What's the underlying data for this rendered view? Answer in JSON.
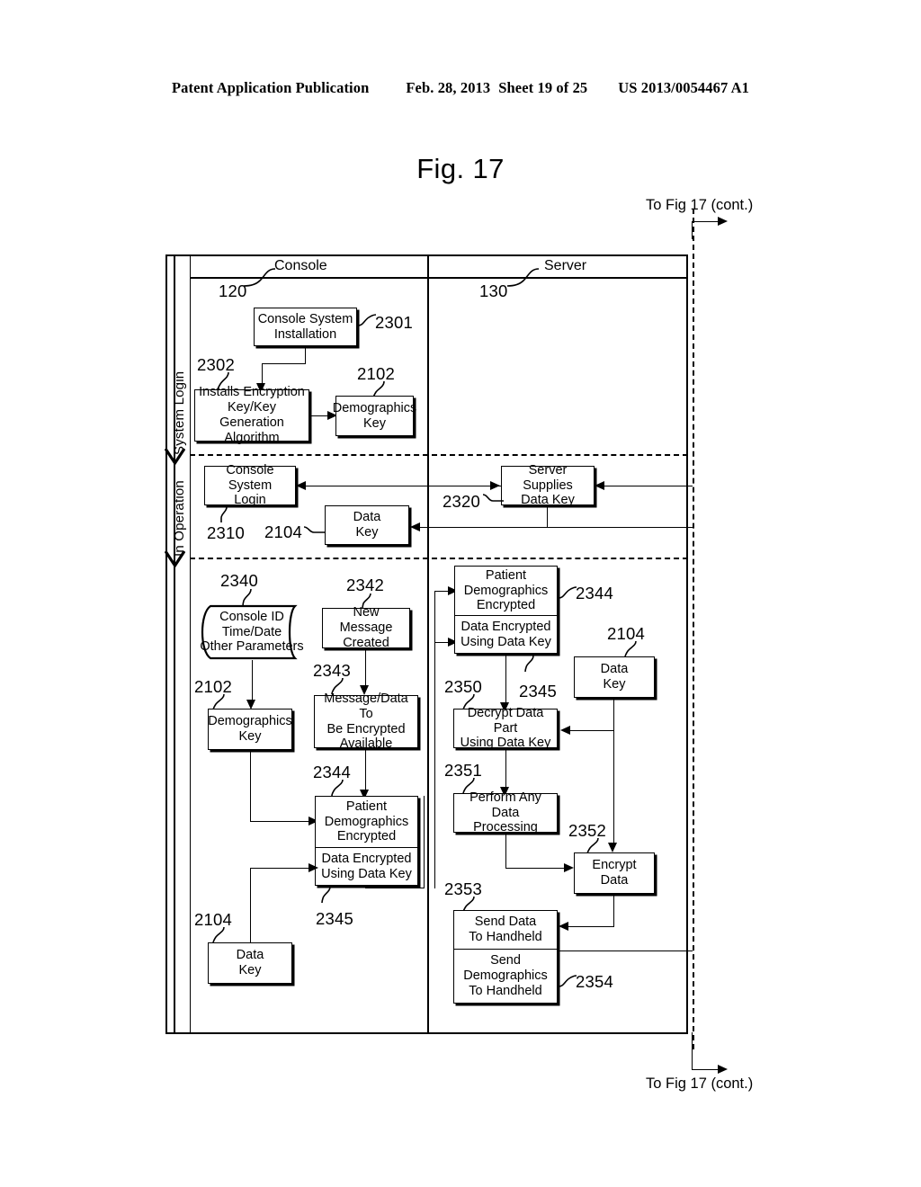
{
  "header": {
    "publication": "Patent Application Publication",
    "date": "Feb. 28, 2013",
    "sheet": "Sheet 19 of 25",
    "patent_number": "US 2013/0054467 A1"
  },
  "figure": {
    "title": "Fig. 17",
    "continuation_top": "To Fig 17 (cont.)",
    "continuation_bottom": "To Fig 17 (cont.)"
  },
  "columns": [
    {
      "label": "Console",
      "ref": "120"
    },
    {
      "label": "Server",
      "ref": "130"
    }
  ],
  "bands": [
    {
      "label": "System Login"
    },
    {
      "label": "In Operation"
    }
  ],
  "nodes": {
    "console_system_installation": {
      "text": "Console System\nInstallation",
      "ref": "2301"
    },
    "installs_encryption_key": {
      "text": "Installs Encryption\nKey/Key Generation\nAlgorithm",
      "ref": "2302"
    },
    "demographics_key_top": {
      "text": "Demographics\nKey",
      "ref": "2102"
    },
    "console_system_login": {
      "text": "Console System\nLogin",
      "ref": "2310"
    },
    "data_key_operation": {
      "text": "Data\nKey",
      "ref": "2104"
    },
    "server_supplies_data_key": {
      "text": "Server Supplies\nData Key",
      "ref": "2320"
    },
    "console_id_params": {
      "text": "Console ID\nTime/Date\nOther Parameters",
      "ref": "2340"
    },
    "new_message_created": {
      "text": "New Message\nCreated",
      "ref": "2342"
    },
    "message_data_to_be_encrypted": {
      "text": "Message/Data To\nBe Encrypted\nAvailable",
      "ref": "2343"
    },
    "demographics_key_console": {
      "text": "Demographics\nKey",
      "ref": "2102"
    },
    "patient_demographics_encrypted_console": {
      "text": "Patient\nDemographics\nEncrypted",
      "ref": "2344"
    },
    "data_encrypted_using_data_key_console": {
      "text": "Data Encrypted\nUsing Data Key",
      "ref": "2345"
    },
    "data_key_console_bottom": {
      "text": "Data\nKey",
      "ref": "2104"
    },
    "patient_demographics_encrypted_server": {
      "text": "Patient\nDemographics\nEncrypted",
      "ref": "2344"
    },
    "data_encrypted_using_data_key_server": {
      "text": "Data Encrypted\nUsing Data Key",
      "ref": "2345"
    },
    "data_key_server": {
      "text": "Data\nKey",
      "ref": "2104"
    },
    "decrypt_data_part": {
      "text": "Decrypt Data Part\nUsing Data Key",
      "ref": "2350"
    },
    "perform_any_data_processing": {
      "text": "Perform Any Data\nProcessing",
      "ref": "2351"
    },
    "encrypt_data": {
      "text": "Encrypt\nData",
      "ref": "2352"
    },
    "send_data_to_handheld": {
      "text": "Send Data\nTo Handheld",
      "ref": "2353"
    },
    "send_demographics_to_handheld": {
      "text": "Send\nDemographics\nTo Handheld",
      "ref": "2354"
    }
  },
  "colors": {
    "ink": "#000000",
    "paper": "#ffffff"
  }
}
